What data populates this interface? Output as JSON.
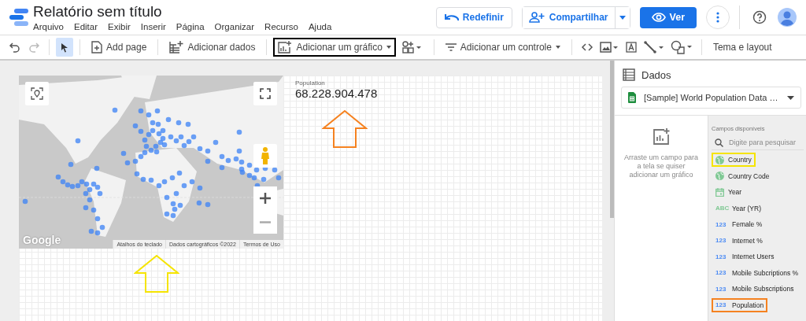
{
  "header": {
    "title": "Relatório sem título",
    "menu": [
      "Arquivo",
      "Editar",
      "Exibir",
      "Inserir",
      "Página",
      "Organizar",
      "Recurso",
      "Ajuda"
    ],
    "reset_button": "Redefinir",
    "share_button": "Compartilhar",
    "view_button": "Ver"
  },
  "toolbar": {
    "add_page": "Add page",
    "add_data": "Adicionar dados",
    "add_chart": {
      "label": "Adicionar um gráfico",
      "color": "#000000"
    },
    "add_control": "Adicionar um controle",
    "theme": "Tema e layout"
  },
  "canvas": {
    "map": {
      "logo": "Google",
      "attribution": [
        "Atalhos do teclado",
        "Dados cartográficos ©2022",
        "Termos de Uso"
      ]
    },
    "scorecard": {
      "label": "Population",
      "value": "68.228.904.478"
    },
    "annotations": [
      {
        "kind": "arrow",
        "color": "#f58220"
      },
      {
        "kind": "arrow",
        "color": "#f5e400"
      }
    ]
  },
  "panel": {
    "title": "Dados",
    "source": "[Sample] World Population Data …",
    "hint": "Arraste um campo para a tela se quiser adicionar um gráfico",
    "fields_title": "Campos disponíveis",
    "search": {
      "placeholder": "Digite para pesquisar"
    },
    "fields": [
      {
        "label": "Country",
        "kind": "geo",
        "color": "#f5e400"
      },
      {
        "label": "Country Code",
        "kind": "geo"
      },
      {
        "label": "Year",
        "kind": "date"
      },
      {
        "label": "Year (YR)",
        "kind": "text",
        "badge": "ABC"
      },
      {
        "label": "Female %",
        "kind": "number",
        "badge": "123"
      },
      {
        "label": "Internet %",
        "kind": "number",
        "badge": "123"
      },
      {
        "label": "Internet Users",
        "kind": "number",
        "badge": "123"
      },
      {
        "label": "Mobile Subcriptions %",
        "kind": "number",
        "badge": "123"
      },
      {
        "label": "Mobile Subscriptions",
        "kind": "number",
        "badge": "123"
      },
      {
        "label": "Population",
        "kind": "number",
        "badge": "123",
        "color": "#f58220"
      }
    ]
  }
}
